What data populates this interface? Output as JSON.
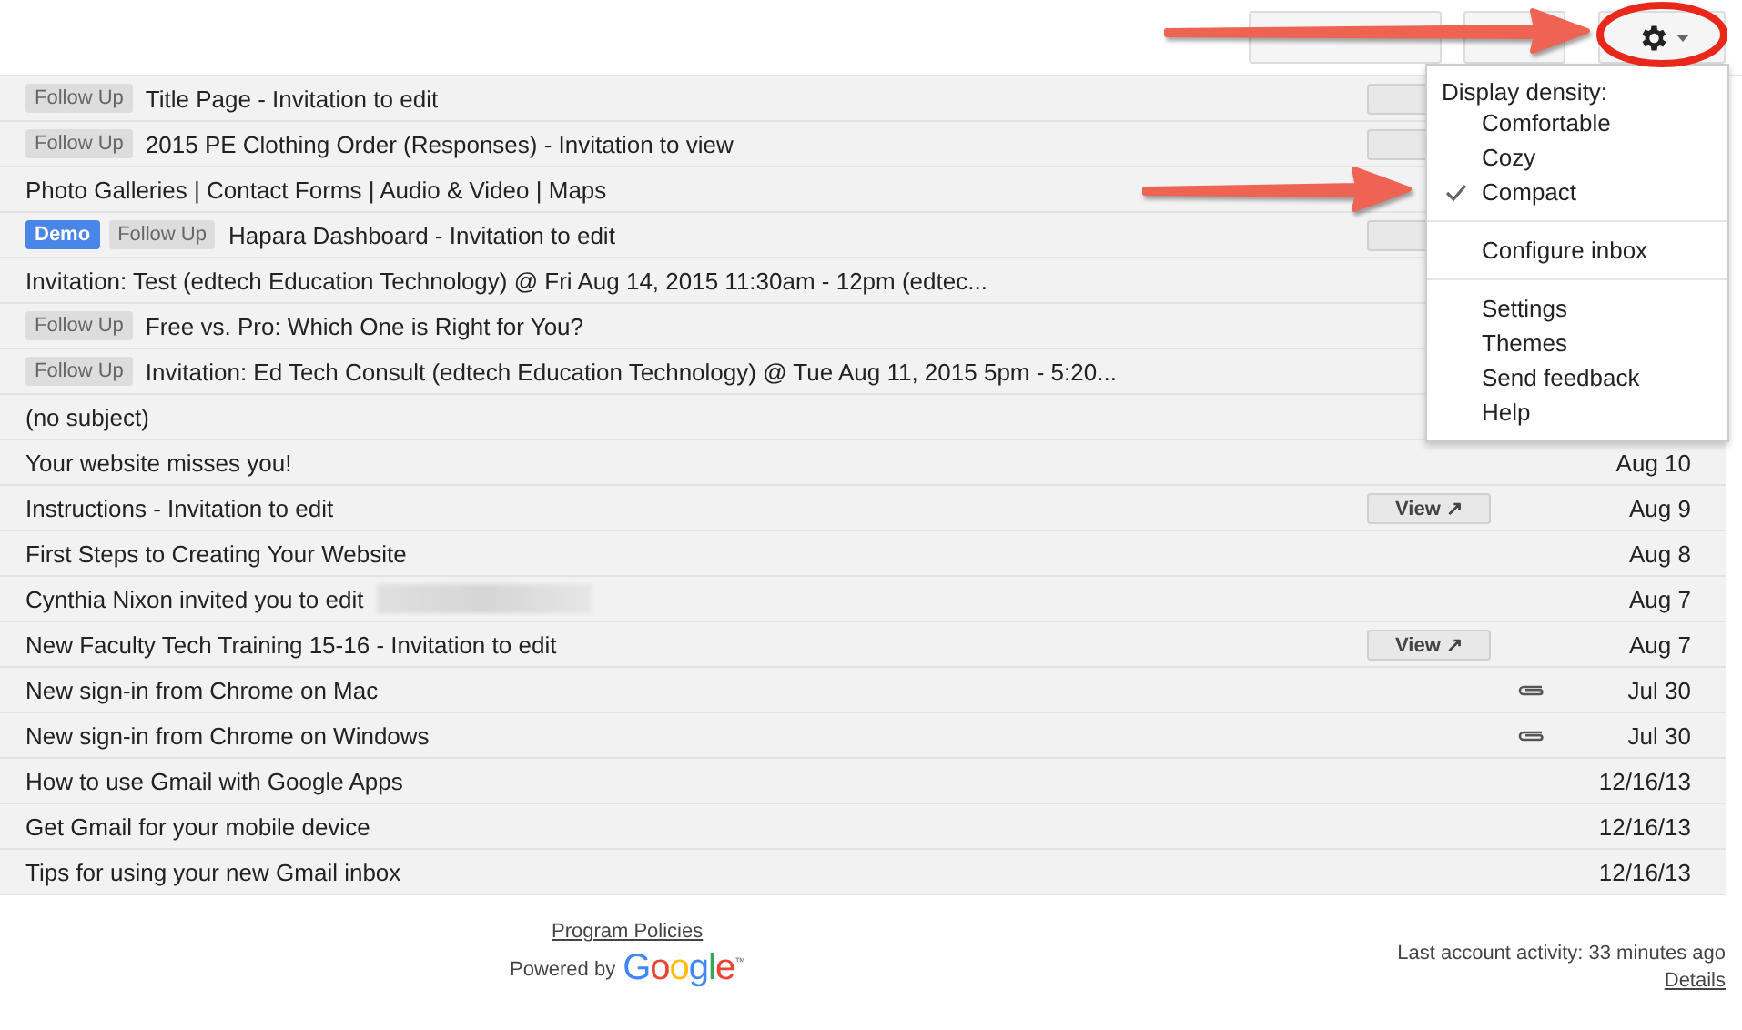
{
  "toolbar": {
    "settings_menu_open": true
  },
  "settings_menu": {
    "heading": "Display density:",
    "sections": [
      {
        "items": [
          {
            "label": "Comfortable",
            "selected": false
          },
          {
            "label": "Cozy",
            "selected": false
          },
          {
            "label": "Compact",
            "selected": true
          }
        ]
      },
      {
        "items": [
          {
            "label": "Configure inbox",
            "selected": false
          }
        ]
      },
      {
        "items": [
          {
            "label": "Settings",
            "selected": false
          },
          {
            "label": "Themes",
            "selected": false
          },
          {
            "label": "Send feedback",
            "selected": false
          },
          {
            "label": "Help",
            "selected": false
          }
        ]
      }
    ]
  },
  "messages": [
    {
      "labels": [
        {
          "text": "Follow Up",
          "kind": "plain"
        }
      ],
      "subject": "Title Page - Invitation to edit",
      "view_stub": true
    },
    {
      "labels": [
        {
          "text": "Follow Up",
          "kind": "plain"
        }
      ],
      "subject": "2015 PE Clothing Order (Responses) - Invitation to view",
      "view_stub": true
    },
    {
      "subject": "Photo Galleries | Contact Forms | Audio & Video | Maps"
    },
    {
      "labels": [
        {
          "text": "Demo",
          "kind": "accent"
        },
        {
          "text": "Follow Up",
          "kind": "plain"
        }
      ],
      "subject": "Hapara Dashboard - Invitation to edit",
      "view_stub": true
    },
    {
      "subject": "Invitation: Test (edtech Education Technology) @ Fri Aug 14, 2015 11:30am - 12pm (edtec..."
    },
    {
      "labels": [
        {
          "text": "Follow Up",
          "kind": "plain"
        }
      ],
      "subject": "Free vs. Pro: Which One is Right for You?"
    },
    {
      "labels": [
        {
          "text": "Follow Up",
          "kind": "plain"
        }
      ],
      "subject": "Invitation: Ed Tech Consult (edtech Education Technology) @ Tue Aug 11, 2015 5pm - 5:20..."
    },
    {
      "subject": "(no subject)"
    },
    {
      "subject": "Your website misses you!",
      "date": "Aug 10"
    },
    {
      "subject": "Instructions - Invitation to edit",
      "view": "View ↗",
      "date": "Aug 9"
    },
    {
      "subject": "First Steps to Creating Your Website",
      "date": "Aug 8"
    },
    {
      "subject": "Cynthia Nixon invited you to edit",
      "redacted": true,
      "date": "Aug 7"
    },
    {
      "subject": "New Faculty Tech Training 15-16 - Invitation to edit",
      "view": "View ↗",
      "date": "Aug 7"
    },
    {
      "subject": "New sign-in from Chrome on Mac",
      "attachment": true,
      "date": "Jul 30"
    },
    {
      "subject": "New sign-in from Chrome on Windows",
      "attachment": true,
      "date": "Jul 30"
    },
    {
      "subject": "How to use Gmail with Google Apps",
      "date": "12/16/13"
    },
    {
      "subject": "Get Gmail for your mobile device",
      "date": "12/16/13"
    },
    {
      "subject": "Tips for using your new Gmail inbox",
      "date": "12/16/13"
    }
  ],
  "footer": {
    "program_policies": "Program Policies",
    "powered_by": "Powered by",
    "logo": "Google",
    "trademark": "™",
    "last_activity": "Last account activity: 33 minutes ago",
    "details": "Details"
  }
}
